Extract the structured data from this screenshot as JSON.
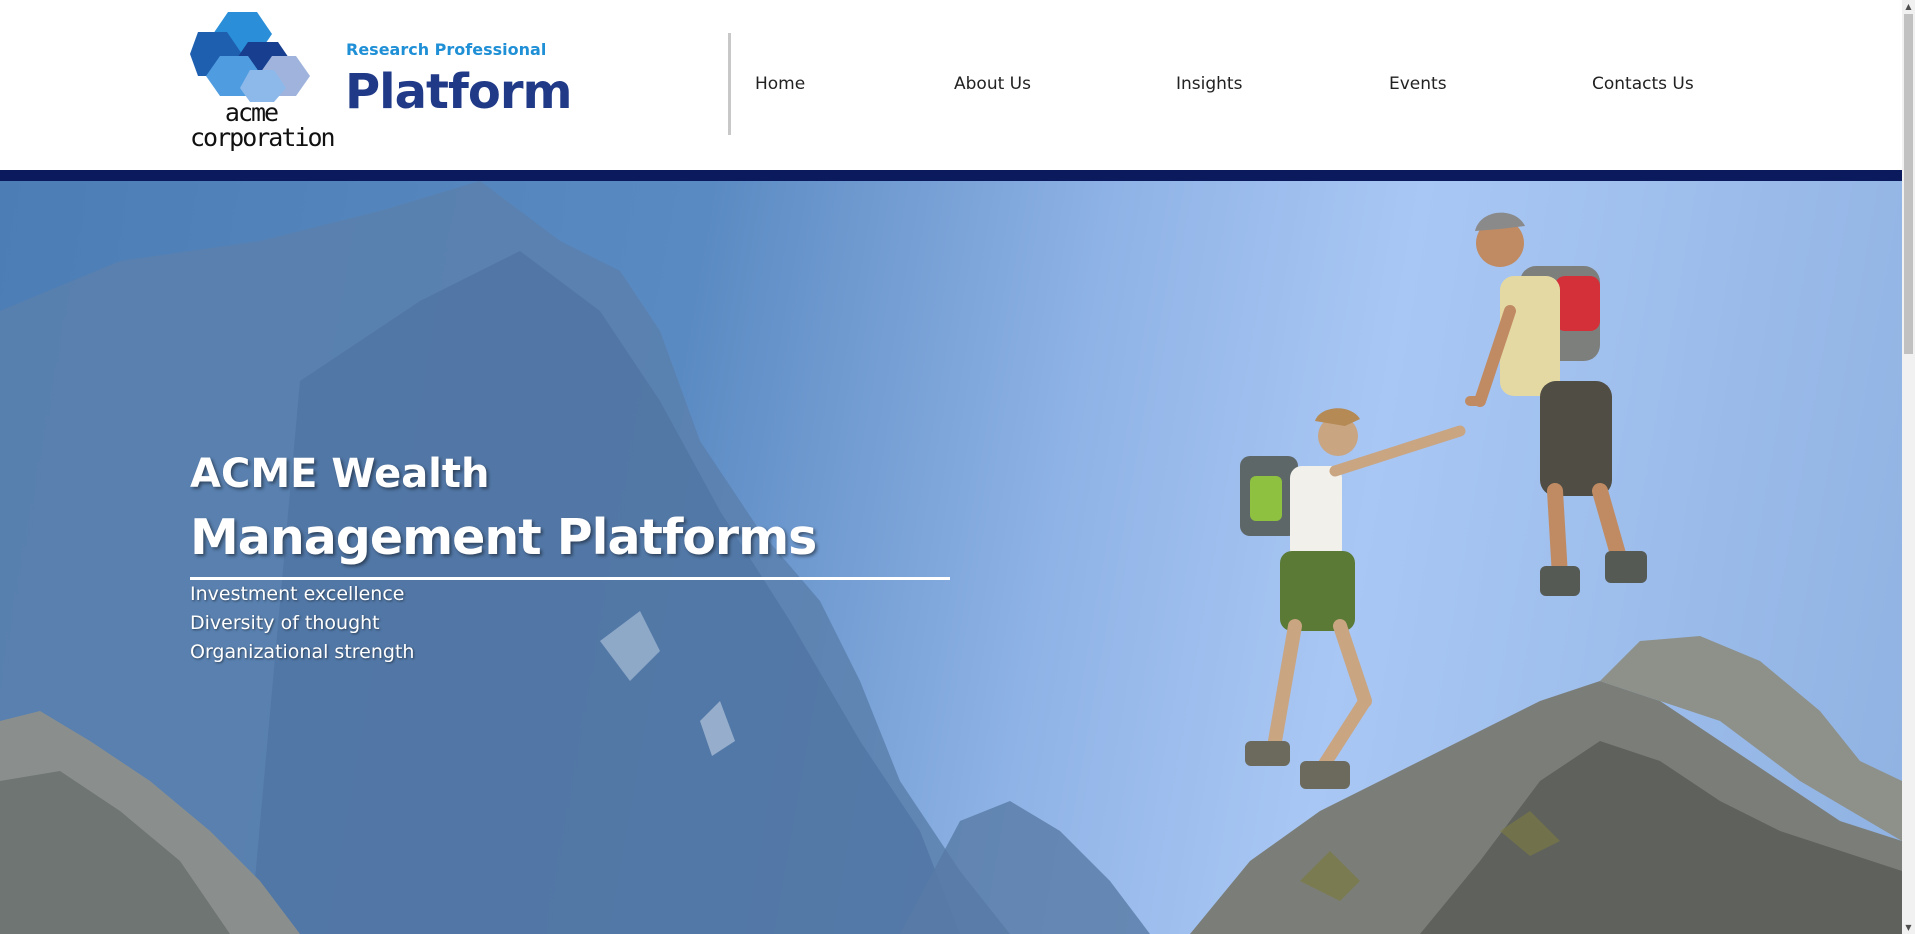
{
  "brand": {
    "logo_text": "acme corporation",
    "subtitle": "Research Professional",
    "title": "Platform"
  },
  "nav": {
    "items": [
      {
        "label": "Home"
      },
      {
        "label": "About Us"
      },
      {
        "label": "Insights"
      },
      {
        "label": "Events"
      },
      {
        "label": "Contacts Us"
      }
    ]
  },
  "hero": {
    "heading_line1": "ACME Wealth",
    "heading_line2": "Management Platforms",
    "bullets": [
      "Investment excellence",
      "Diversity of thought",
      "Organizational strength"
    ]
  },
  "colors": {
    "brand_blue": "#203a88",
    "accent_blue": "#1f8fd6",
    "header_bar": "#0b1a5c"
  },
  "icons": {
    "scroll_up": "▲",
    "scroll_down": "▼"
  }
}
